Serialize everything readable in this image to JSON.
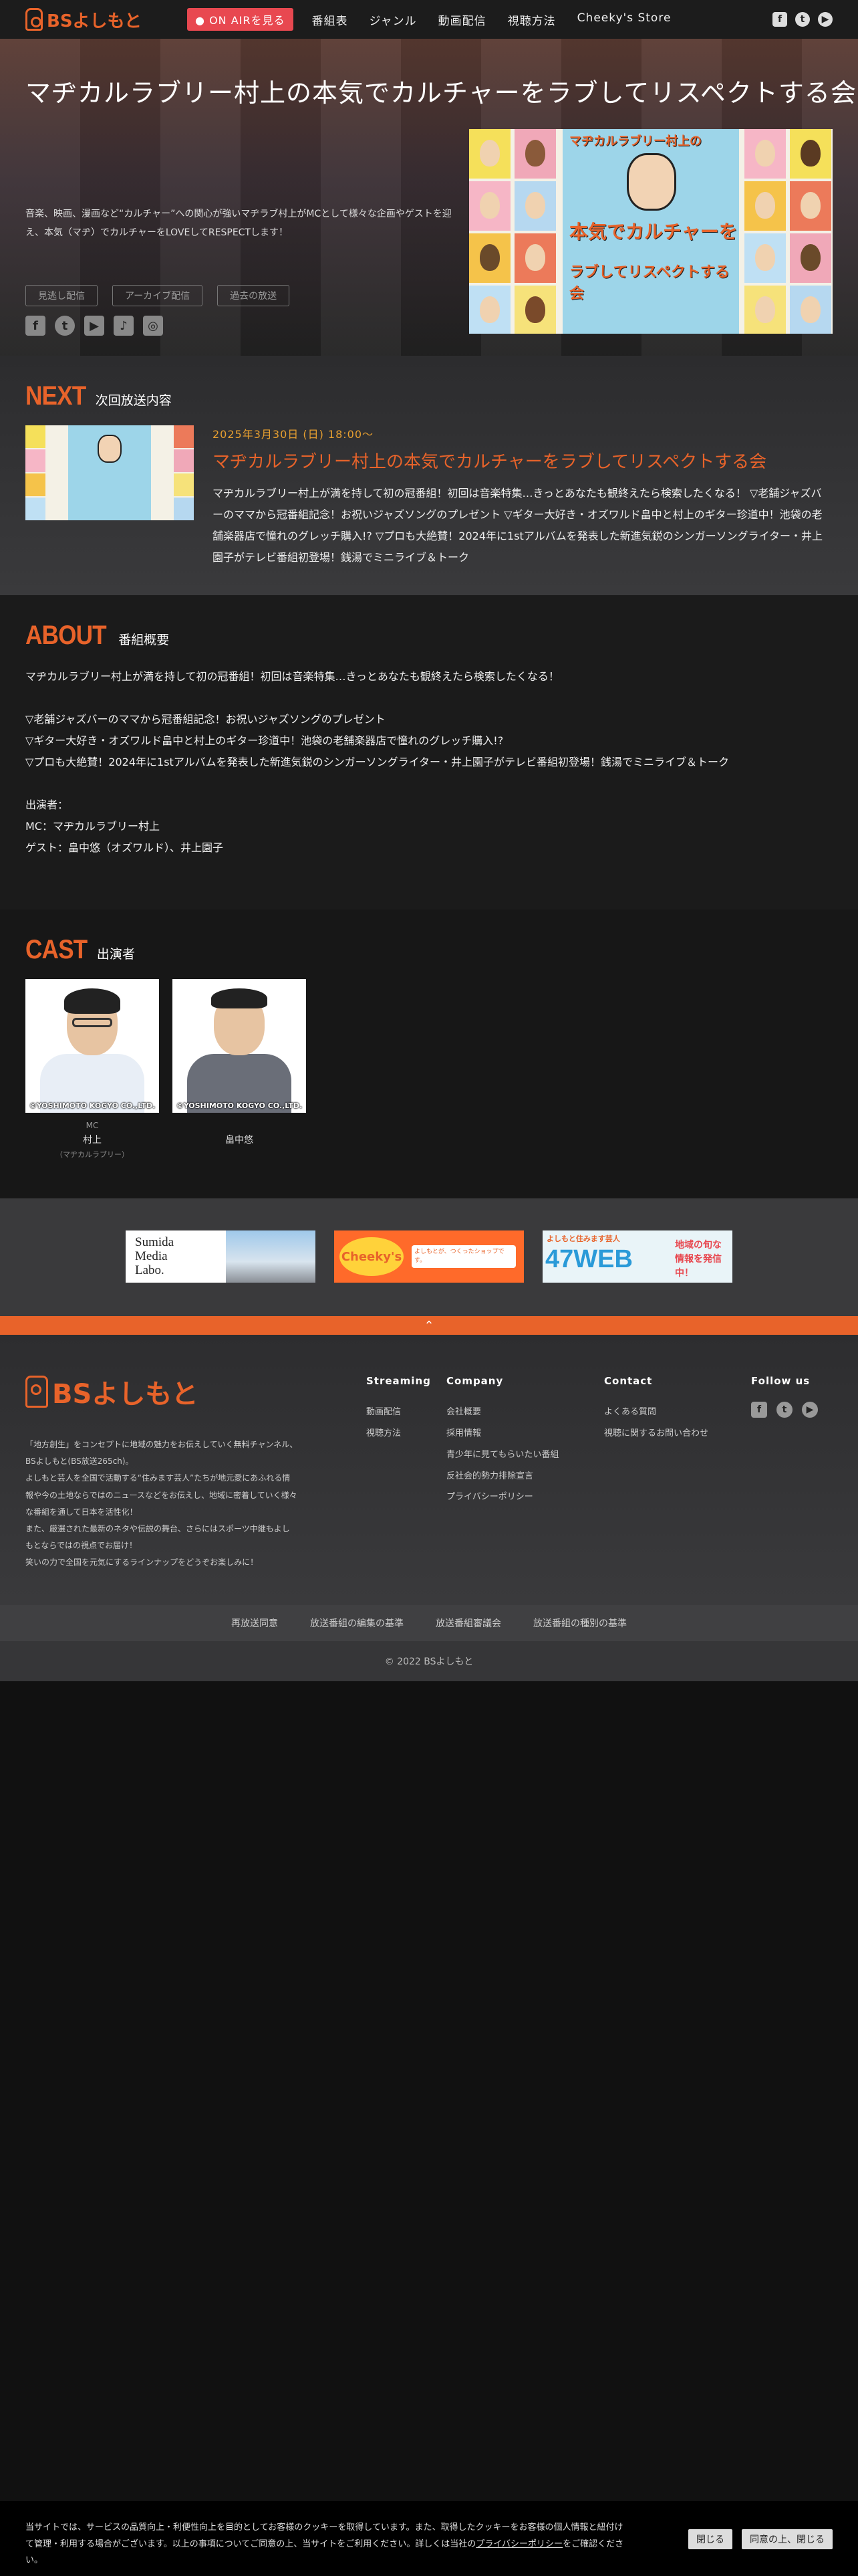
{
  "header": {
    "logo": "BSよしもと",
    "onair": "ON AIRを見る",
    "nav": [
      "番組表",
      "ジャンル",
      "動画配信",
      "視聴方法",
      "Cheeky's Store"
    ],
    "social": [
      "facebook-icon",
      "twitter-icon",
      "youtube-icon"
    ]
  },
  "hero": {
    "title": "マヂカルラブリー村上の本気でカルチャーをラブしてリスペクトする会",
    "desc": "音楽、映画、漫画など“カルチャー”への関心が強いマヂラブ村上がMCとして様々な企画やゲストを迎え、本気（マヂ）でカルチャーをLOVEしてRESPECTします！",
    "tabs": [
      "見逃し配信",
      "アーカイブ配信",
      "過去の放送"
    ],
    "social": [
      "facebook-icon",
      "twitter-icon",
      "youtube-icon",
      "tiktok-icon",
      "instagram-icon"
    ],
    "kv_title_lines": [
      "マヂカルラブリー村上の",
      "本気でカルチャーを",
      "ラブしてリスペクトする会"
    ]
  },
  "next": {
    "big": "NEXT",
    "small": "次回放送内容",
    "date": "2025年3月30日 (日) 18:00〜",
    "title": "マヂカルラブリー村上の本気でカルチャーをラブしてリスペクトする会",
    "desc": "マヂカルラブリー村上が満を持して初の冠番組！初回は音楽特集…きっとあなたも観終えたら検索したくなる！ ▽老舗ジャズバーのママから冠番組記念！お祝いジャズソングのプレゼント ▽ギター大好き・オズワルド畠中と村上のギター珍道中！池袋の老舗楽器店で憧れのグレッチ購入!? ▽プロも大絶賛！2024年に1stアルバムを発表した新進気鋭のシンガーソングライター・井上園子がテレビ番組初登場！銭湯でミニライブ＆トーク"
  },
  "about": {
    "big": "ABOUT",
    "small": "番組概要",
    "lines": [
      "マヂカルラブリー村上が満を持して初の冠番組！初回は音楽特集…きっとあなたも観終えたら検索したくなる！",
      "",
      "▽老舗ジャズバーのママから冠番組記念！お祝いジャズソングのプレゼント",
      "▽ギター大好き・オズワルド畠中と村上のギター珍道中！池袋の老舗楽器店で憧れのグレッチ購入!?",
      "▽プロも大絶賛！2024年に1stアルバムを発表した新進気鋭のシンガーソングライター・井上園子がテレビ番組初登場！銭湯でミニライブ＆トーク",
      "",
      "出演者：",
      "MC：マヂカルラブリー村上",
      "ゲスト：畠中悠（オズワルド）、井上園子"
    ]
  },
  "cast": {
    "big": "CAST",
    "small": "出演者",
    "members": [
      {
        "role": "MC",
        "name": "村上",
        "sub": "（マヂカルラブリー）",
        "copyright": "©YOSHIMOTO KOGYO CO.,LTD."
      },
      {
        "role": "",
        "name": "畠中悠",
        "sub": "",
        "copyright": "©YOSHIMOTO KOGYO CO.,LTD."
      }
    ]
  },
  "banners": [
    {
      "name": "Sumida Media Labo.",
      "lines": [
        "Sumida",
        "Media",
        "Labo."
      ]
    },
    {
      "name": "Cheeky's",
      "text": "Cheeky's",
      "sub": "よしもとが、つくったショップです。"
    },
    {
      "name": "47WEB",
      "brand": "よしもと住みます芸人",
      "text": "47WEB",
      "sub": "地域の旬な情報を発信中！"
    }
  ],
  "pagetop": "⌃",
  "footer": {
    "logo": "BSよしもと",
    "desc": [
      "「地方創生」をコンセプトに地域の魅力をお伝えしていく無料チャンネル、",
      "BSよしもと(BS放送265ch)。",
      "よしもと芸人を全国で活動する“住みます芸人”たちが地元愛にあふれる情",
      "報や今の土地ならではのニュースなどをお伝えし、地域に密着していく様々",
      "な番組を通して日本を活性化！",
      "また、厳選された最新のネタや伝説の舞台、さらにはスポーツ中継もよし",
      "もとならではの視点でお届け！",
      "笑いの力で全国を元気にするラインナップをどうぞお楽しみに！"
    ],
    "streaming": {
      "title": "Streaming",
      "items": [
        "動画配信",
        "視聴方法"
      ]
    },
    "company": {
      "title": "Company",
      "items": [
        "会社概要",
        "採用情報",
        "青少年に見てもらいたい番組",
        "反社会的勢力排除宣言",
        "プライバシーポリシー"
      ]
    },
    "contact": {
      "title": "Contact",
      "items": [
        "よくある質問",
        "視聴に関するお問い合わせ"
      ]
    },
    "follow": {
      "title": "Follow us",
      "icons": [
        "facebook-icon",
        "twitter-icon",
        "youtube-icon"
      ]
    },
    "bottom_links": [
      "再放送同意",
      "放送番組の編集の基準",
      "放送番組審議会",
      "放送番組の種別の基準"
    ],
    "copyright": "© 2022 BSよしもと"
  },
  "cookie": {
    "text_before": "当サイトでは、サービスの品質向上・利便性向上を目的としてお客様のクッキーを取得しています。また、取得したクッキーをお客様の個人情報と紐付けて管理・利用する場合がございます。以上の事項についてご同意の上、当サイトをご利用ください。詳しくは当社の",
    "link": "プライバシーポリシー",
    "text_after": "をご確認ください。",
    "close": "閉じる",
    "agree": "同意の上、閉じる"
  },
  "colors": {
    "accent": "#e8632a",
    "onair": "#e84850",
    "date": "#e8a030"
  }
}
